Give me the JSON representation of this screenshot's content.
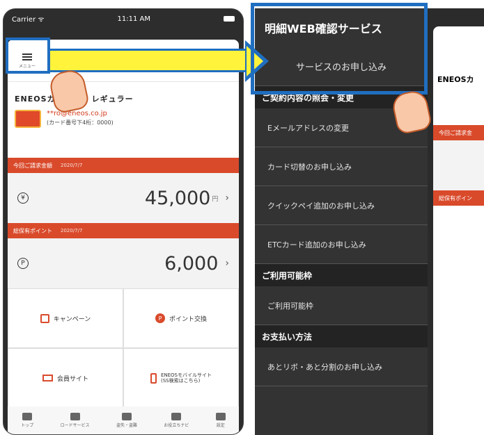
{
  "status": {
    "carrier": "Carrier ᯤ",
    "time": "11:11 AM"
  },
  "header": {
    "menu_label": "メニュー"
  },
  "card": {
    "name": "ENEOSカード CB レギュラー",
    "email": "**ro@eneos.co.jp",
    "number": "(カード番号下4桁：0000)"
  },
  "billing": {
    "label": "今回ご請求金額",
    "date": "2020/7/7",
    "amount": "45,000",
    "unit": "円",
    "icon": "¥"
  },
  "points": {
    "label": "総保有ポイント",
    "date": "2020/7/7",
    "amount": "6,000",
    "icon": "P"
  },
  "grid": {
    "campaign": "キャンペーン",
    "points_exchange": "ポイント交換",
    "member_site": "会員サイト",
    "mobile_site": "ENEOSモバイルサイト",
    "mobile_site_sub": "(SS検索はこちら)"
  },
  "tabs": [
    {
      "label": "トップ"
    },
    {
      "label": "ロードサービス"
    },
    {
      "label": "盗失・盗難"
    },
    {
      "label": "お役立ちナビ"
    },
    {
      "label": "設定"
    }
  ],
  "menu": {
    "title": "明細WEB確認サービス",
    "apply": "サービスのお申し込み",
    "section_contract": "ご契約内容の照会・変更",
    "email_change": "Eメールアドレスの変更",
    "card_switch": "カード切替のお申し込み",
    "quickpay": "クイックペイ追加のお申し込み",
    "etc": "ETCカード追加のお申し込み",
    "section_limit": "ご利用可能枠",
    "limit": "ご利用可能枠",
    "section_payment": "お支払い方法",
    "revo": "あとリボ・あと分割のお申し込み"
  },
  "peek": {
    "card_name": "ENEOSカ",
    "billing_label": "今回ご請求金",
    "points_label": "総保有ポイン"
  },
  "colors": {
    "accent": "#d94a2b",
    "highlight": "#1f6ec0",
    "arrow": "#fff33b"
  }
}
